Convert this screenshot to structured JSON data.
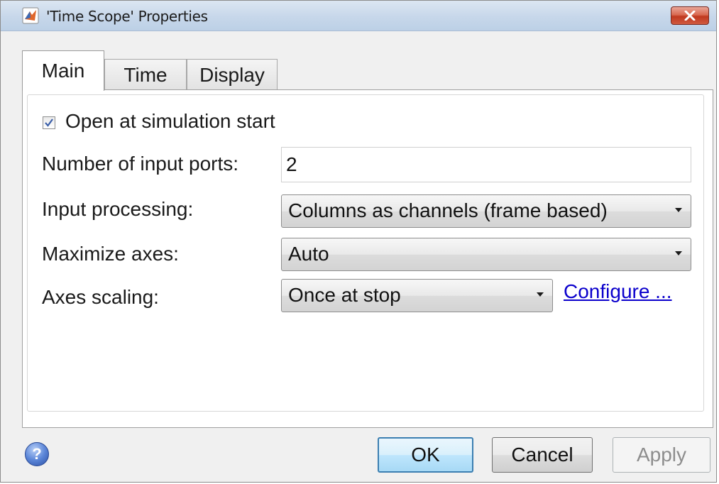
{
  "window": {
    "title": "'Time Scope' Properties"
  },
  "tabs": [
    {
      "label": "Main",
      "active": true
    },
    {
      "label": "Time",
      "active": false
    },
    {
      "label": "Display",
      "active": false
    }
  ],
  "main": {
    "open_at_start": {
      "label": "Open at simulation start",
      "checked": true
    },
    "num_input_ports": {
      "label": "Number of input ports:",
      "value": "2"
    },
    "input_processing": {
      "label": "Input processing:",
      "value": "Columns as channels (frame based)"
    },
    "maximize_axes": {
      "label": "Maximize axes:",
      "value": "Auto"
    },
    "axes_scaling": {
      "label": "Axes scaling:",
      "value": "Once at stop",
      "configure_link": "Configure ..."
    }
  },
  "footer": {
    "ok_label": "OK",
    "cancel_label": "Cancel",
    "apply_label": "Apply"
  },
  "colors": {
    "link": "#0b00cc",
    "titlebar": "#c7d7ea",
    "close_button": "#c0391f"
  }
}
